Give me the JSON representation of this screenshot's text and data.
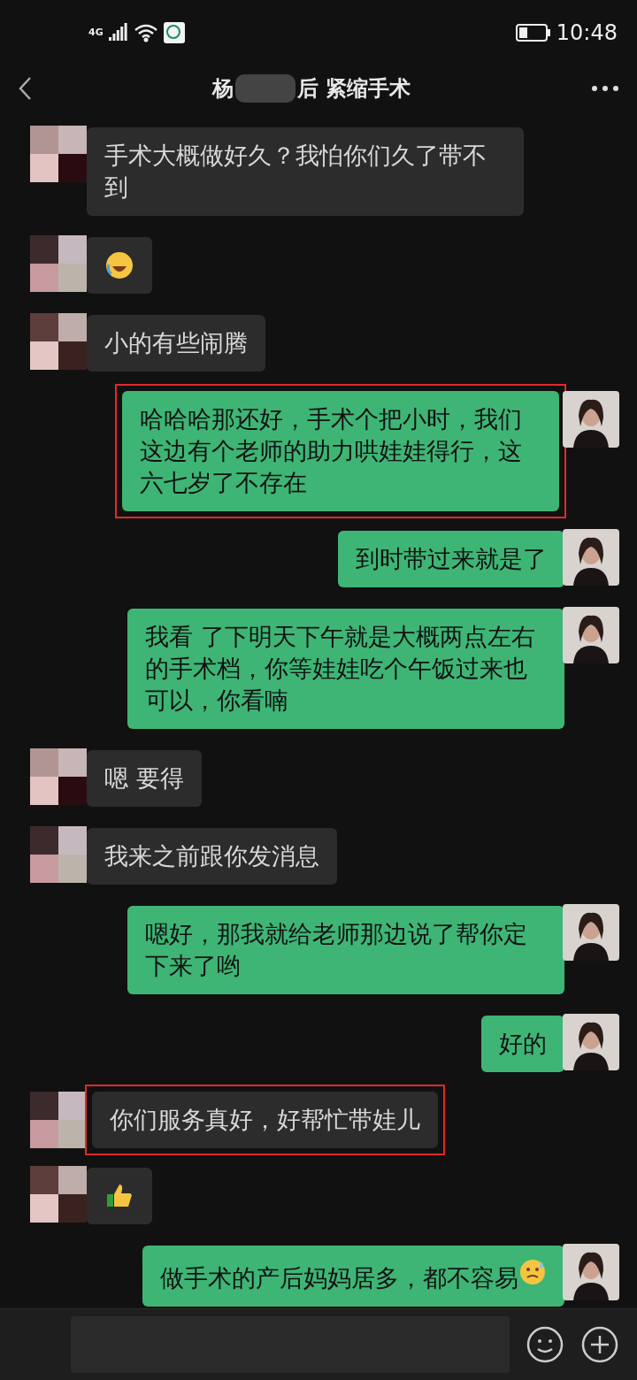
{
  "status_bar": {
    "network": "4G",
    "time": "10:48"
  },
  "header": {
    "title_start": "杨",
    "title_end": "后 紧缩手术"
  },
  "messages": [
    {
      "outgoing": false,
      "kind": "text",
      "text": "手术大概做好久？我怕你们久了带不到",
      "highlighted": false
    },
    {
      "outgoing": false,
      "kind": "sticker",
      "emoji": {
        "kind": "laugh-cry"
      },
      "highlighted": false
    },
    {
      "outgoing": false,
      "kind": "text",
      "text": "小的有些闹腾",
      "highlighted": false
    },
    {
      "outgoing": true,
      "kind": "text",
      "text": "哈哈哈那还好，手术个把小时，我们这边有个老师的助力哄娃娃得行，这六七岁了不存在",
      "highlighted": true
    },
    {
      "outgoing": true,
      "kind": "text",
      "text": "到时带过来就是了",
      "highlighted": false
    },
    {
      "outgoing": true,
      "kind": "text",
      "text": "我看 了下明天下午就是大概两点左右的手术档，你等娃娃吃个午饭过来也可以，你看喃",
      "highlighted": false
    },
    {
      "outgoing": false,
      "kind": "text",
      "text": "嗯 要得",
      "highlighted": false
    },
    {
      "outgoing": false,
      "kind": "text",
      "text": "我来之前跟你发消息",
      "highlighted": false
    },
    {
      "outgoing": true,
      "kind": "text",
      "text": "嗯好，那我就给老师那边说了帮你定下来了哟",
      "highlighted": false
    },
    {
      "outgoing": true,
      "kind": "text",
      "text": "好的",
      "highlighted": false
    },
    {
      "outgoing": false,
      "kind": "text",
      "text": "你们服务真好，好帮忙带娃儿",
      "highlighted": true
    },
    {
      "outgoing": false,
      "kind": "sticker",
      "emoji": {
        "kind": "thumbs-up"
      },
      "highlighted": false
    },
    {
      "outgoing": true,
      "kind": "text",
      "text": "做手术的产后妈妈居多，都不容易",
      "emoji": {
        "kind": "sweat"
      },
      "highlighted": false
    }
  ]
}
